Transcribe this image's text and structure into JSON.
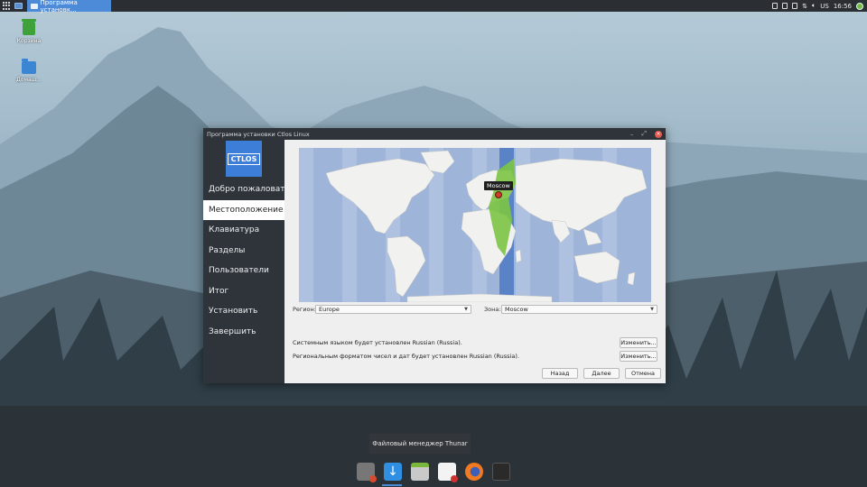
{
  "taskbar": {
    "active_window_title": "Программа установк...",
    "keyboard_layout": "US",
    "clock": "16:56"
  },
  "desktop": {
    "icons": [
      {
        "label": "Корзина",
        "icon": "trash-icon"
      },
      {
        "label": "Домаш...",
        "icon": "home-folder-icon"
      }
    ]
  },
  "window": {
    "title": "Программа установки Ctlos Linux",
    "logo_text": "CTLOS",
    "nav": [
      {
        "label": "Добро пожаловать"
      },
      {
        "label": "Местоположение",
        "active": true
      },
      {
        "label": "Клавиатура"
      },
      {
        "label": "Разделы"
      },
      {
        "label": "Пользователи"
      },
      {
        "label": "Итог"
      },
      {
        "label": "Установить"
      },
      {
        "label": "Завершить"
      }
    ],
    "map": {
      "tooltip": "Moscow"
    },
    "region_label": "Регион:",
    "region_value": "Europe",
    "zone_label": "Зона:",
    "zone_value": "Moscow",
    "language_text": "Системным языком будет установлен Russian (Russia).",
    "format_text": "Региональным форматом чисел и дат будет установлен Russian (Russia).",
    "change_button": "Изменить...",
    "change_button_2": "Изменить...",
    "back_button": "Назад",
    "next_button": "Далее",
    "cancel_button": "Отмена"
  },
  "dock": {
    "tooltip": "Файловый менеджер Thunar",
    "items": [
      "settings-app-icon",
      "installer-icon",
      "thunar-file-manager-icon",
      "text-editor-icon",
      "firefox-icon",
      "terminal-icon"
    ]
  },
  "colors": {
    "accent": "#4d8ad8",
    "panel": "#2b2e33",
    "timezone_highlight": "#7bc442"
  }
}
